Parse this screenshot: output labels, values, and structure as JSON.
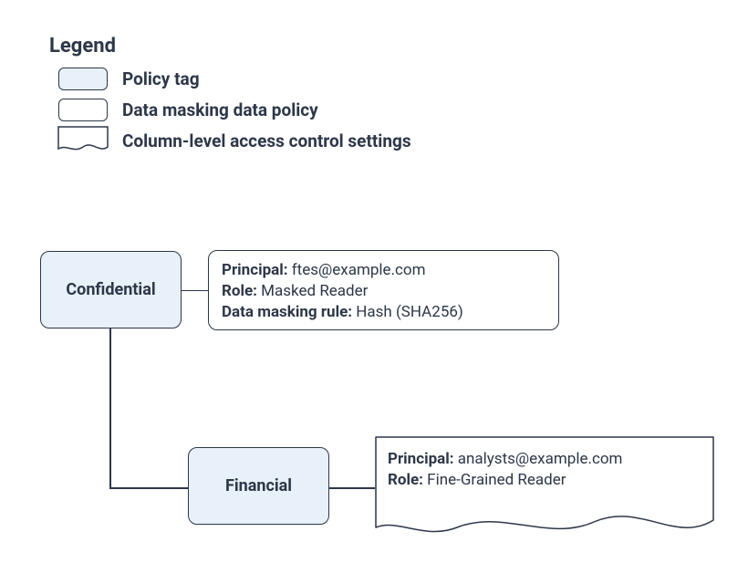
{
  "legend": {
    "title": "Legend",
    "items": [
      {
        "label": "Policy tag"
      },
      {
        "label": "Data masking data policy"
      },
      {
        "label": "Column-level access control settings"
      }
    ]
  },
  "nodes": {
    "confidential": {
      "label": "Confidential",
      "policy": {
        "principal_k": "Principal:",
        "principal_v": " ftes@example.com",
        "role_k": "Role:",
        "role_v": " Masked Reader",
        "rule_k": "Data masking rule:",
        "rule_v": " Hash (SHA256)"
      }
    },
    "financial": {
      "label": "Financial",
      "clac": {
        "principal_k": "Principal:",
        "principal_v": " analysts@example.com",
        "role_k": "Role:",
        "role_v": " Fine-Grained Reader"
      }
    }
  },
  "colors": {
    "stroke": "#2d3748",
    "policy_fill": "#e8f0fa"
  }
}
